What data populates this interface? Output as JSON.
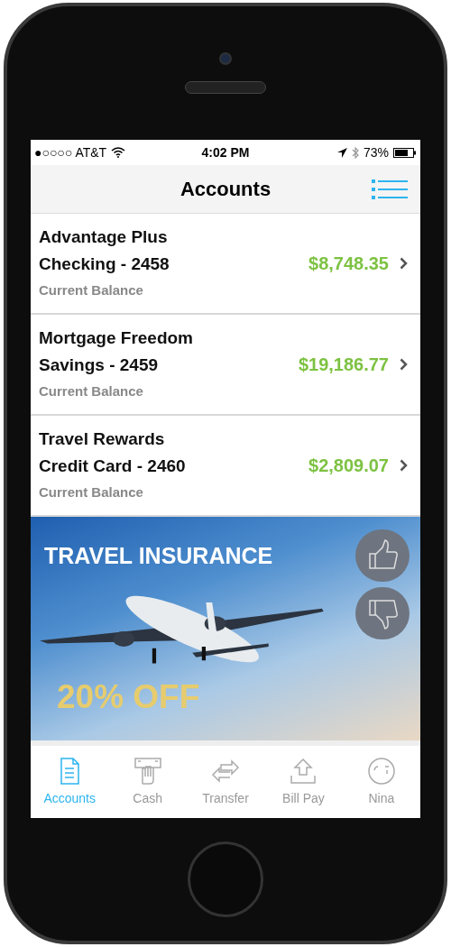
{
  "status_bar": {
    "carrier": "●○○○○ AT&T",
    "time": "4:02 PM",
    "battery": "73%"
  },
  "nav": {
    "title": "Accounts"
  },
  "accounts": [
    {
      "name_line_1": "Advantage Plus",
      "name_line_2": "Checking - 2458",
      "balance": "$8,748.35",
      "caption": "Current Balance"
    },
    {
      "name_line_1": "Mortgage Freedom",
      "name_line_2": "Savings - 2459",
      "balance": "$19,186.77",
      "caption": "Current Balance"
    },
    {
      "name_line_1": "Travel Rewards",
      "name_line_2": "Credit Card - 2460",
      "balance": "$2,809.07",
      "caption": "Current Balance"
    }
  ],
  "banner": {
    "headline": "TRAVEL INSURANCE",
    "offer": "20% OFF"
  },
  "tabs": [
    {
      "label": "Accounts",
      "kind": "document",
      "selected": true
    },
    {
      "label": "Cash",
      "kind": "cash",
      "selected": false
    },
    {
      "label": "Transfer",
      "kind": "transfer",
      "selected": false
    },
    {
      "label": "Bill Pay",
      "kind": "billpay",
      "selected": false
    },
    {
      "label": "Nina",
      "kind": "chat",
      "selected": false
    }
  ]
}
